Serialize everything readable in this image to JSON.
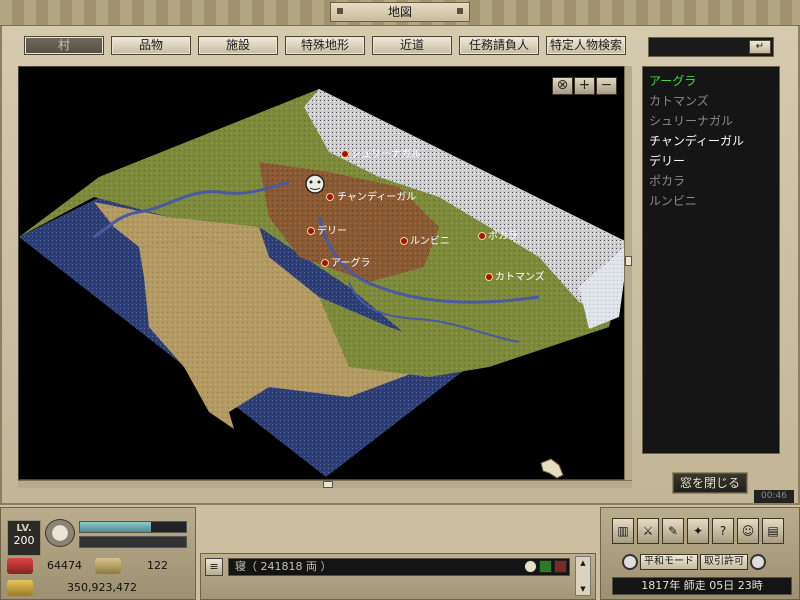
{
  "window": {
    "title": "地図"
  },
  "filters": [
    {
      "label": "村",
      "active": true
    },
    {
      "label": "品物",
      "active": false
    },
    {
      "label": "施設",
      "active": false
    },
    {
      "label": "特殊地形",
      "active": false
    },
    {
      "label": "近道",
      "active": false
    },
    {
      "label": "任務請負人",
      "active": false
    },
    {
      "label": "特定人物検索",
      "active": false
    }
  ],
  "search": {
    "value": "",
    "enter_icon": "↵"
  },
  "zoom": {
    "reset_icon": "⊗",
    "in_icon": "+",
    "out_icon": "−"
  },
  "map": {
    "cities": [
      {
        "name": "シュリーナガル"
      },
      {
        "name": "チャンディーガル"
      },
      {
        "name": "デリー"
      },
      {
        "name": "ルンビニ"
      },
      {
        "name": "ポカラ"
      },
      {
        "name": "アーグラ"
      },
      {
        "name": "カトマンズ"
      }
    ]
  },
  "town_list": [
    {
      "name": "アーグラ",
      "color": "#3fdc3f"
    },
    {
      "name": "カトマンズ",
      "color": "#8a8a8a"
    },
    {
      "name": "シュリーナガル",
      "color": "#8a8a8a"
    },
    {
      "name": "チャンディーガル",
      "color": "#ffffff"
    },
    {
      "name": "デリー",
      "color": "#ffffff"
    },
    {
      "name": "ポカラ",
      "color": "#8a8a8a"
    },
    {
      "name": "ルンビニ",
      "color": "#8a8a8a"
    }
  ],
  "close_button": "窓を閉じる",
  "clock": "00:46",
  "player": {
    "level_label": "LV.",
    "level": "200",
    "hp_fraction": 0.67,
    "stat1": "64474",
    "stat2": "122",
    "money": "350,923,472"
  },
  "chat": {
    "text": "寝（ 241818 両 ）"
  },
  "modes": {
    "mode1": "平和モード",
    "mode2": "取引許可"
  },
  "date": "1817年 師走 05日 23時",
  "colors": {
    "accent_green": "#3fdc3f",
    "panel_bg": "#151515"
  }
}
